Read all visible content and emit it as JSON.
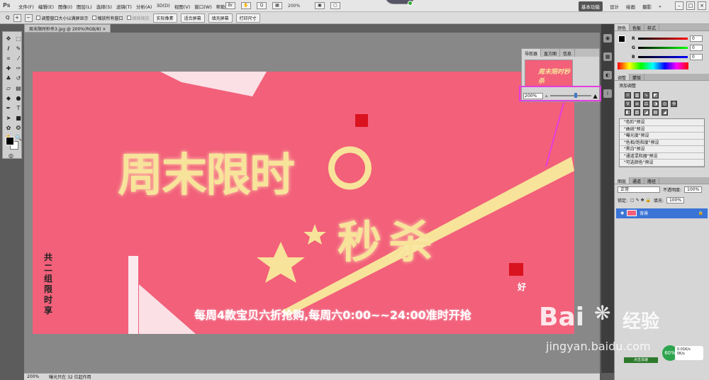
{
  "menubar": {
    "app_logo": "Ps",
    "menus": [
      "文件(F)",
      "编辑(E)",
      "图像(I)",
      "图层(L)",
      "选择(S)",
      "滤镜(T)",
      "分析(A)",
      "3D(D)",
      "视图(V)",
      "窗口(W)",
      "帮助(H)"
    ],
    "zoom": "200%",
    "workspaces": [
      "基本功能",
      "设计",
      "绘画",
      "摄影"
    ],
    "workspace_active": "基本功能",
    "window_controls": [
      "–",
      "□",
      "×"
    ]
  },
  "options": {
    "zoom_label": "Q",
    "checkboxes": [
      {
        "label": "调整窗口大小以满屏显示",
        "disabled": false
      },
      {
        "label": "缩放所有窗口",
        "disabled": false
      },
      {
        "label": "细微缩放",
        "disabled": true
      }
    ],
    "buttons": [
      "实际像素",
      "适合屏幕",
      "填充屏幕",
      "打印尺寸"
    ]
  },
  "document": {
    "tab_title": "周末限时秒杀3.jpg @ 200%(RGB/8)",
    "close": "×",
    "headline": "周末限时",
    "subheadline": "秒杀",
    "slogan": "每周4款宝贝六折抢购,每周六0:00~~24:00准时开抢",
    "side_text": "共二组限时享",
    "small_text": "好"
  },
  "status": {
    "zoom": "200%",
    "info": "曝光只在 32 位起作用"
  },
  "navigator": {
    "tabs": [
      "导航器",
      "直方图",
      "信息"
    ],
    "active": "导航器",
    "zoom_value": "200%",
    "thumb_title": "周末限时秒杀"
  },
  "color_panel": {
    "tabs": [
      "颜色",
      "色板",
      "样式"
    ],
    "channels": [
      {
        "name": "R",
        "value": "0"
      },
      {
        "name": "G",
        "value": "0"
      },
      {
        "name": "B",
        "value": "0"
      }
    ]
  },
  "adjustments": {
    "tabs": [
      "调整",
      "蒙版"
    ],
    "title": "添加调整",
    "presets": [
      "\"色阶\"预设",
      "\"曲线\"预设",
      "\"曝光度\"预设",
      "\"色相/饱和度\"预设",
      "\"黑白\"预设",
      "\"通道混和器\"预设",
      "\"可选颜色\"预设"
    ]
  },
  "layers": {
    "tabs": [
      "图层",
      "通道",
      "路径"
    ],
    "blend_mode": "正常",
    "opacity_label": "不透明度:",
    "opacity": "100%",
    "lock_label": "锁定:",
    "fill_label": "填充:",
    "fill": "100%",
    "layer_name": "背景"
  },
  "watermark": {
    "brand": "Bai",
    "brand2": "经验",
    "url": "jingyan.baidu.com"
  },
  "network": {
    "percent": "60%",
    "up": "0.01K/s",
    "down": "0K/s",
    "label": "点击加速"
  },
  "colors": {
    "canvas": "#f2607a",
    "accent": "#3a74d6",
    "highlight": "#e23ee0",
    "text": "#f7e39a"
  }
}
